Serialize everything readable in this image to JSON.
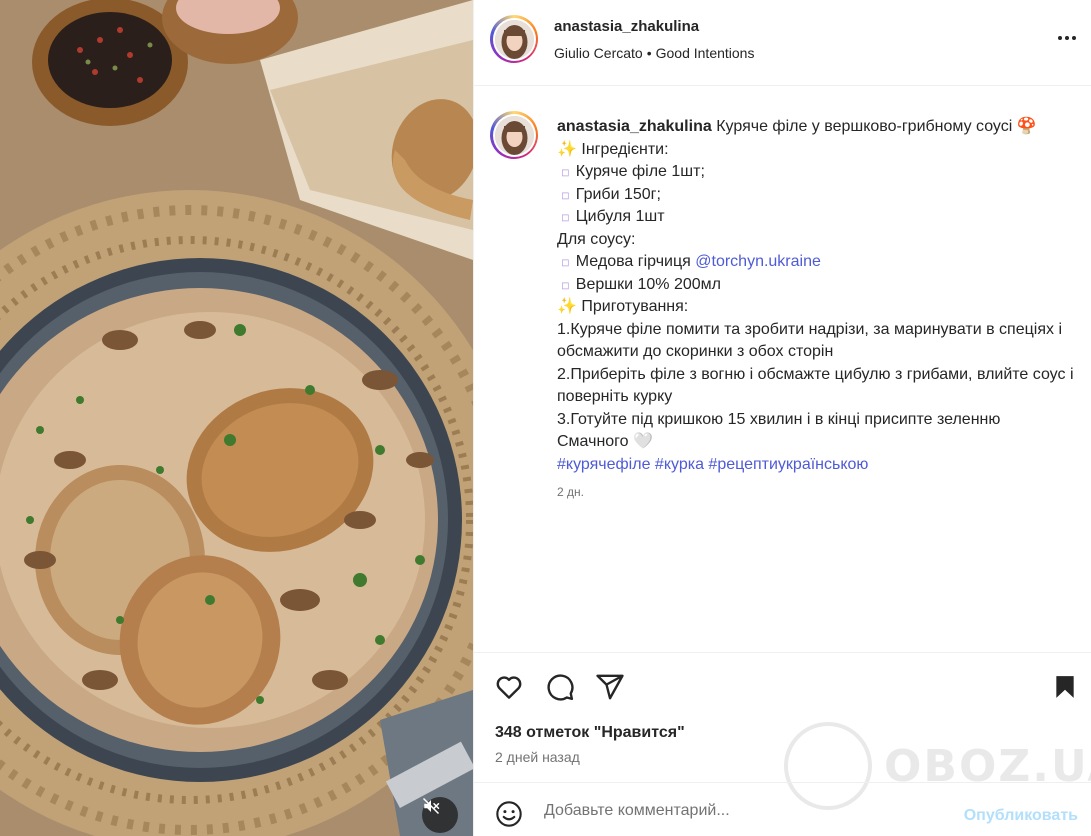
{
  "post": {
    "username": "anastasia_zhakulina",
    "music_artist": "Giulio Cercato",
    "music_separator": "•",
    "music_track": "Good Intentions",
    "more_icon": "more-horizontal-icon"
  },
  "caption": {
    "username": "anastasia_zhakulina",
    "title": "Куряче філе у вершково-грибному соусі",
    "title_emoji": "🍄",
    "ingredients_heading": "Інгредієнти:",
    "sparkle": "✨",
    "bullet": "▫️",
    "ingredients": [
      "Куряче філе 1шт;",
      "Гриби 150г;",
      "Цибуля 1шт"
    ],
    "sauce_heading": "Для соусу:",
    "sauce_item_1_prefix": "Медова гірчиця",
    "sauce_item_1_link": "@torchyn.ukraine",
    "sauce_item_2": "Вершки 10% 200мл",
    "prep_heading": "Приготування:",
    "step_1": "1.Куряче філе помити та зробити надрізи, за маринувати в спеціях і обсмажити до скоринки з обох сторін",
    "step_2": "2.Приберіть філе з вогню і обсмажте цибулю з грибами, влийте соус і поверніть курку",
    "step_3": "3.Готуйте під кришкою 15 хвилин і в кінці присипте зеленню",
    "closing": "Смачного",
    "closing_emoji": "🤍",
    "hashtags": "#куряче філе #курка #рецептиукраїнською",
    "hashtag_1": "#курячефіле",
    "hashtag_2": "#курка",
    "hashtag_3": "#рецептиукраїнською",
    "time": "2 дн."
  },
  "actions": {
    "like_icon": "heart-icon",
    "comment_icon": "comment-icon",
    "share_icon": "share-icon",
    "save_icon": "bookmark-icon",
    "likes_text": "348 отметок \"Нравится\"",
    "posted_ago": "2 дней назад"
  },
  "comment_box": {
    "placeholder": "Добавьте комментарий...",
    "publish_label": "Опубликовать",
    "emoji_icon": "emoji-icon"
  },
  "watermark": {
    "text": "OBOZ.UA"
  },
  "colors": {
    "link": "#4f5bd5",
    "publish": "#b2dffc",
    "text": "#262626",
    "muted": "#737373"
  }
}
